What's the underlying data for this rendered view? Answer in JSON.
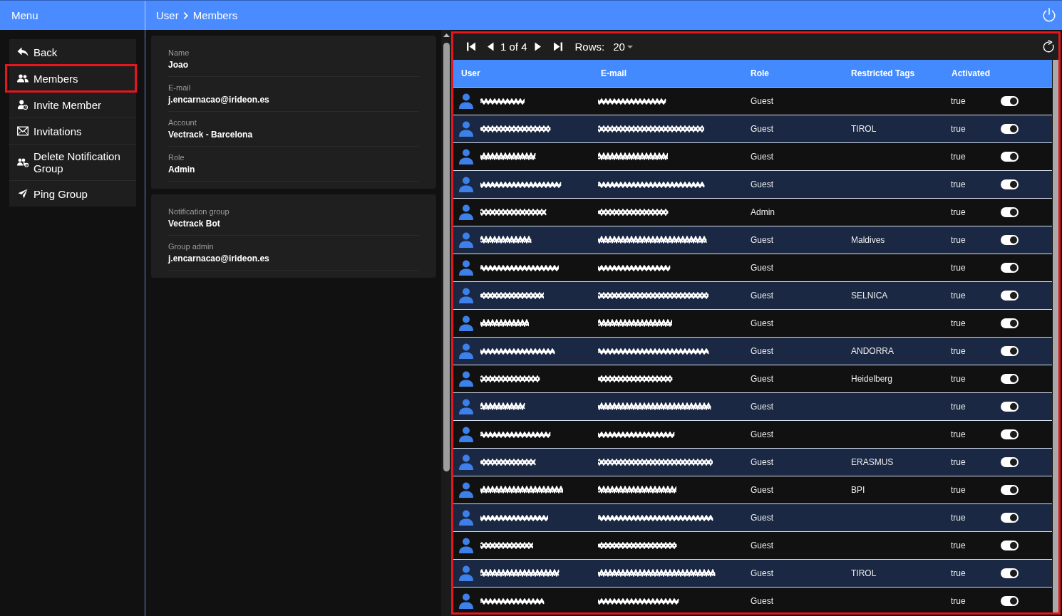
{
  "header": {
    "menu_title": "Menu",
    "breadcrumb": [
      "User",
      "Members"
    ]
  },
  "sidebar": {
    "items": [
      {
        "kind": "back",
        "label": "Back",
        "highlighted": false
      },
      {
        "kind": "members",
        "label": "Members",
        "highlighted": true
      },
      {
        "kind": "invite",
        "label": "Invite Member",
        "highlighted": false
      },
      {
        "kind": "invitations",
        "label": "Invitations",
        "highlighted": false
      },
      {
        "kind": "delete-group",
        "label": "Delete Notification Group",
        "highlighted": false
      },
      {
        "kind": "ping",
        "label": "Ping Group",
        "highlighted": false
      }
    ]
  },
  "details": {
    "cards": [
      {
        "fields": [
          {
            "label": "Name",
            "value": "Joao"
          },
          {
            "label": "E-mail",
            "value": "j.encarnacao@irideon.es"
          },
          {
            "label": "Account",
            "value": "Vectrack - Barcelona"
          },
          {
            "label": "Role",
            "value": "Admin"
          }
        ]
      },
      {
        "fields": [
          {
            "label": "Notification group",
            "value": "Vectrack Bot"
          },
          {
            "label": "Group admin",
            "value": "j.encarnacao@irideon.es"
          }
        ]
      }
    ]
  },
  "table": {
    "highlighted": true,
    "pager": {
      "page": "1 of 4",
      "rows_label": "Rows:",
      "rows_value": "20"
    },
    "columns": [
      "User",
      "E-mail",
      "Role",
      "Restricted Tags",
      "Activated"
    ],
    "rows": [
      {
        "redacted": true,
        "role": "Guest",
        "activated": "true",
        "on": true
      },
      {
        "redacted": true,
        "role": "Guest",
        "tags": "TIROL",
        "activated": "true",
        "on": true
      },
      {
        "redacted": true,
        "role": "Guest",
        "activated": "true",
        "on": true
      },
      {
        "redacted": true,
        "role": "Guest",
        "activated": "true",
        "on": true
      },
      {
        "redacted": true,
        "role": "Admin",
        "activated": "true",
        "on": true
      },
      {
        "redacted": true,
        "role": "Guest",
        "tags": "Maldives",
        "activated": "true",
        "on": true
      },
      {
        "redacted": true,
        "role": "Guest",
        "activated": "true",
        "on": true
      },
      {
        "redacted": true,
        "role": "Guest",
        "tags": "SELNICA",
        "activated": "true",
        "on": true
      },
      {
        "redacted": true,
        "role": "Guest",
        "activated": "true",
        "on": true
      },
      {
        "redacted": true,
        "role": "Guest",
        "tags": "ANDORRA",
        "activated": "true",
        "on": true
      },
      {
        "redacted": true,
        "role": "Guest",
        "tags": "Heidelberg",
        "activated": "true",
        "on": true
      },
      {
        "redacted": true,
        "role": "Guest",
        "activated": "true",
        "on": true
      },
      {
        "redacted": true,
        "role": "Guest",
        "activated": "true",
        "on": true
      },
      {
        "redacted": true,
        "role": "Guest",
        "tags": "ERASMUS",
        "activated": "true",
        "on": true
      },
      {
        "redacted": true,
        "role": "Guest",
        "tags": "BPI",
        "activated": "true",
        "on": true
      },
      {
        "redacted": true,
        "role": "Guest",
        "activated": "true",
        "on": true
      },
      {
        "redacted": true,
        "role": "Guest",
        "activated": "true",
        "on": true
      },
      {
        "redacted": true,
        "role": "Guest",
        "tags": "TIROL",
        "activated": "true",
        "on": true
      },
      {
        "redacted": true,
        "role": "Guest",
        "activated": "true",
        "on": true
      }
    ]
  }
}
